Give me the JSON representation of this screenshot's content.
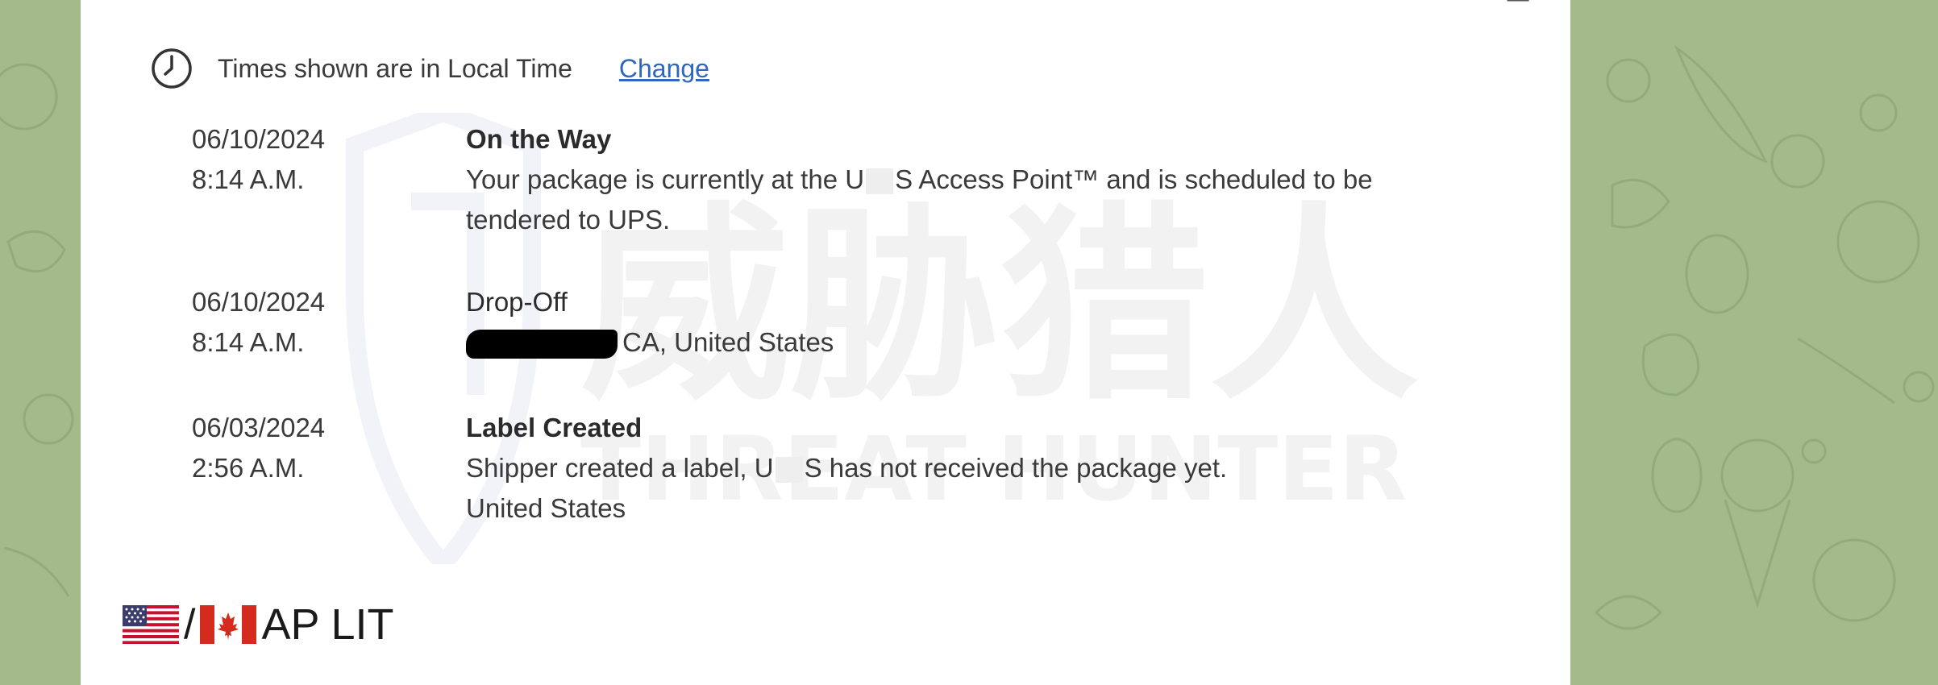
{
  "timezone": {
    "text": "Times shown are in Local Time",
    "change_link": "Change"
  },
  "events": [
    {
      "date": "06/10/2024",
      "time": "8:14 A.M.",
      "status": "On the Way",
      "detail_before": "Your package is currently at the U",
      "detail_after": "S Access Point™ and is scheduled to be",
      "detail_line2": "tendered to UPS."
    },
    {
      "date": "06/10/2024",
      "time": "8:14 A.M.",
      "status": "Drop-Off",
      "location": "CA, United States"
    },
    {
      "date": "06/03/2024",
      "time": "2:56 A.M.",
      "status": "Label Created",
      "detail_before": "Shipper created a label, U",
      "detail_after": "S has not received the package yet.",
      "detail_line2": "United States"
    }
  ],
  "footer": {
    "slash": "/",
    "text": "AP LIT"
  },
  "icons": {
    "clock": "clock-icon",
    "us_flag": "us-flag-icon",
    "ca_flag": "canada-flag-icon"
  },
  "colors": {
    "link": "#2f66c2",
    "background": "#a3bb8a",
    "card": "#ffffff"
  }
}
